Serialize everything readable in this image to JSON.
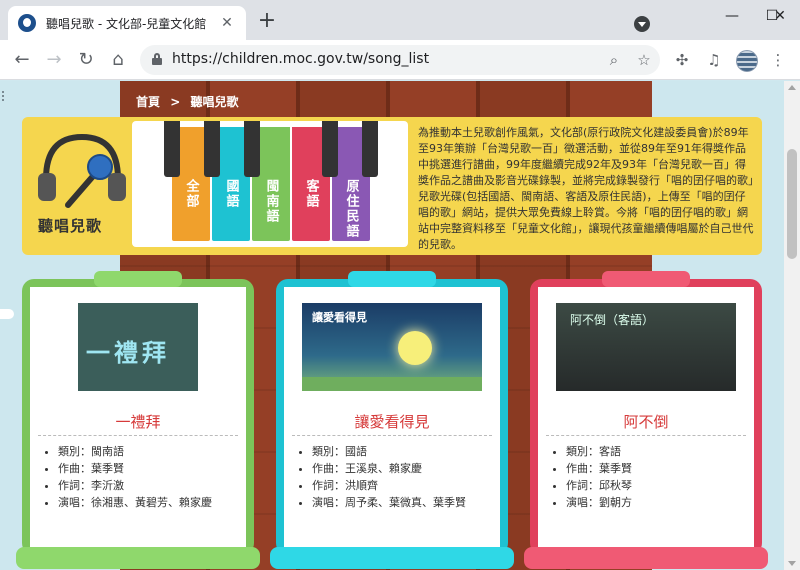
{
  "browser": {
    "tab_title": "聽唱兒歌 - 文化部-兒童文化館",
    "tab_close": "✕",
    "new_tab": "+",
    "url": "https://children.moc.gov.tw/song_list",
    "minimize": "—",
    "maximize": "☐",
    "close": "✕",
    "back": "←",
    "forward": "→",
    "reload": "↻",
    "home": "⌂"
  },
  "breadcrumb": [
    "首頁",
    ">",
    "聽唱兒歌"
  ],
  "banner": {
    "logo_text": "聽唱兒歌",
    "keys": [
      {
        "label": "全部",
        "color": "#f0a02c"
      },
      {
        "label": "國語",
        "color": "#1ec2d2"
      },
      {
        "label": "閩南語",
        "color": "#7cc45a"
      },
      {
        "label": "客語",
        "color": "#e0405c"
      },
      {
        "label": "原住民語",
        "color": "#8a58b4"
      }
    ],
    "intro": "為推動本土兒歌創作風氣，文化部(原行政院文化建設委員會)於89年至93年策辦「台灣兒歌一百」徵選活動，並從89年至91年得獎作品中挑選進行譜曲，99年度繼續完成92年及93年「台灣兒歌一百」得獎作品之譜曲及影音光碟錄製，並將完成錄製發行「唱的囝仔唱的歌」兒歌光碟(包括國語、閩南語、客語及原住民語)，上傳至「唱的囝仔唱的歌」網站，提供大眾免費線上聆賞。今將「唱的囝仔唱的歌」網站中完整資料移至「兒童文化館」，讓現代孩童繼續傳唱屬於自己世代的兒歌。"
  },
  "songs": [
    {
      "title": "一禮拜",
      "thumb_text": "一禮拜",
      "color": "#7cc45a",
      "info": [
        "類別：閩南語",
        "作曲：葉季賢",
        "作詞：李沂激",
        "演唱：徐湘惠、黃碧芳、賴家慶"
      ]
    },
    {
      "title": "讓愛看得見",
      "thumb_text": "讓愛看得見",
      "color": "#1ec2d2",
      "info": [
        "類別：國語",
        "作曲：王溪泉、賴家慶",
        "作詞：洪順齊",
        "演唱：周予柔、葉微真、葉季賢"
      ]
    },
    {
      "title": "阿不倒",
      "thumb_text": "阿不倒（客語）",
      "color": "#e0405c",
      "info": [
        "類別：客語",
        "作曲：葉季賢",
        "作詞：邱秋琴",
        "演唱：劉朝方"
      ]
    }
  ]
}
